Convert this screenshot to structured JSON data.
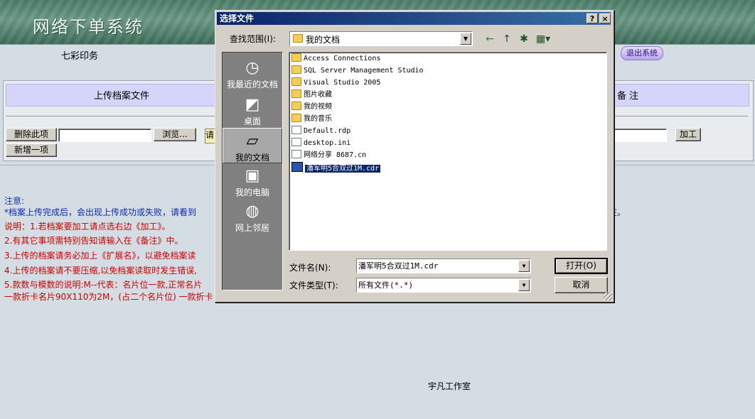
{
  "app": {
    "title": "网络下单系统",
    "company": "七彩印务",
    "logout": "退出系统"
  },
  "form": {
    "col_upload": "上传档案文件",
    "col_note": "备注",
    "delete_btn": "删除此项",
    "browse_btn": "浏览...",
    "yellow_value": "请",
    "process_btn": "加工",
    "add_btn": "新增一项"
  },
  "notes": {
    "title": "注意:",
    "line0": "*档案上传完成后，会出现上传成功或失败，请看到",
    "line0_end": "在。",
    "line1": "说明：1.若档案要加工请点选右边《加工》。",
    "line2": "2.有其它事项需特别告知请输入在《备注》中。",
    "line3": "3.上传的档案请务必加上《扩展名》，以避免档案读",
    "line4": "4.上传的档案请不要压缩,以免档案读取时发生错误,",
    "line5": "5.款数与模数的说明:M--代表：名片位一款,正常名片",
    "line6": "一款折卡名片90X110为2M，(占二个名片位) 一款折卡",
    "line6_end": "。",
    "studio": "宇凡工作室"
  },
  "dialog": {
    "title": "选择文件",
    "help": "?",
    "close": "×",
    "lookin_label": "查找范围(I):",
    "lookin_value": "我的文档",
    "tools": {
      "back": "←",
      "up": "↑",
      "new": "✱",
      "view": "▦▾"
    },
    "places": [
      {
        "label": "我最近的文档",
        "icon": "◷"
      },
      {
        "label": "桌面",
        "icon": "◩"
      },
      {
        "label": "我的文档",
        "icon": "▱"
      },
      {
        "label": "我的电脑",
        "icon": "▣"
      },
      {
        "label": "网上邻居",
        "icon": "◍"
      }
    ],
    "files": [
      {
        "name": "Access Connections",
        "kind": "folder"
      },
      {
        "name": "SQL Server Management Studio",
        "kind": "folder"
      },
      {
        "name": "Visual Studio 2005",
        "kind": "folder"
      },
      {
        "name": "图片收藏",
        "kind": "folder"
      },
      {
        "name": "我的视频",
        "kind": "folder"
      },
      {
        "name": "我的音乐",
        "kind": "folder"
      },
      {
        "name": "Default.rdp",
        "kind": "file"
      },
      {
        "name": "desktop.ini",
        "kind": "file"
      },
      {
        "name": "网络分享 8687.cn",
        "kind": "file"
      },
      {
        "name": "潘军明5合双过1M.cdr",
        "kind": "file",
        "selected": true
      }
    ],
    "filename_label": "文件名(N):",
    "filename_value": "潘军明5合双过1M.cdr",
    "filetype_label": "文件类型(T):",
    "filetype_value": "所有文件(*.*)",
    "open_btn": "打开(O)",
    "cancel_btn": "取消"
  }
}
